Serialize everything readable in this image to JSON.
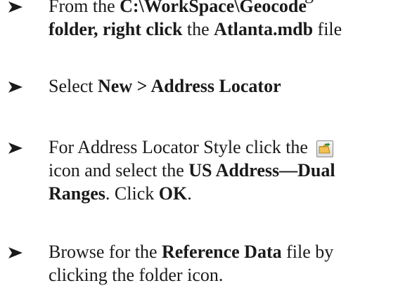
{
  "top_fragment": "ng",
  "steps": [
    {
      "parts": [
        {
          "t": "From the ",
          "b": false
        },
        {
          "t": "C:\\WorkSpace\\Geocode",
          "b": true
        },
        {
          "t": " ",
          "b": false
        },
        {
          "t": "folder, right click",
          "b": true
        },
        {
          "t": " the ",
          "b": false
        },
        {
          "t": "Atlanta.mdb",
          "b": true
        },
        {
          "t": " file",
          "b": false
        }
      ]
    },
    {
      "parts": [
        {
          "t": "Select ",
          "b": false
        },
        {
          "t": "New > Address Locator",
          "b": true
        }
      ]
    },
    {
      "parts": [
        {
          "t": "For Address Locator Style click the ",
          "b": false
        },
        {
          "icon": "open-folder-icon"
        },
        {
          "t": " icon and select the ",
          "b": false
        },
        {
          "t": "US Address—Dual Ranges",
          "b": true
        },
        {
          "t": ". Click ",
          "b": false
        },
        {
          "t": "OK",
          "b": true
        },
        {
          "t": ".",
          "b": false
        }
      ]
    },
    {
      "parts": [
        {
          "t": "Browse for the ",
          "b": false
        },
        {
          "t": "Reference Data",
          "b": true
        },
        {
          "t": " file by clicking the folder icon.",
          "b": false
        }
      ]
    }
  ]
}
